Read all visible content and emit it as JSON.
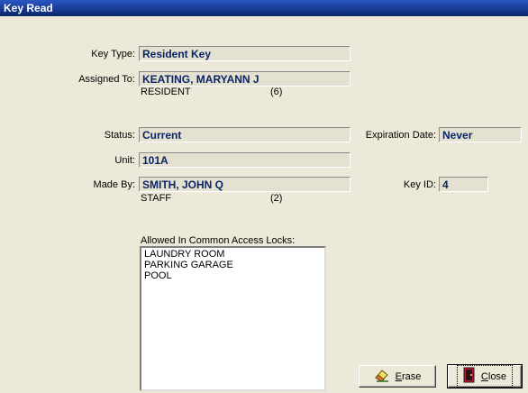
{
  "window": {
    "title": "Key Read"
  },
  "fields": {
    "key_type_label": "Key Type:",
    "key_type_value": "Resident Key",
    "assigned_to_label": "Assigned To:",
    "assigned_to_value": "KEATING, MARYANN J",
    "assigned_role": "RESIDENT",
    "assigned_count": "(6)",
    "status_label": "Status:",
    "status_value": "Current",
    "expiration_label": "Expiration Date:",
    "expiration_value": "Never",
    "unit_label": "Unit:",
    "unit_value": "101A",
    "made_by_label": "Made By:",
    "made_by_value": "SMITH, JOHN Q",
    "made_by_role": "STAFF",
    "made_by_count": "(2)",
    "key_id_label": "Key ID:",
    "key_id_value": "4"
  },
  "locks": {
    "label": "Allowed In Common Access Locks:",
    "items": [
      "LAUNDRY ROOM",
      "PARKING GARAGE",
      "POOL"
    ]
  },
  "buttons": {
    "erase_mnemonic": "E",
    "erase_rest": "rase",
    "close_mnemonic": "C",
    "close_rest": "lose"
  },
  "icons": {
    "erase": "eraser-icon",
    "close": "door-exit-icon"
  }
}
